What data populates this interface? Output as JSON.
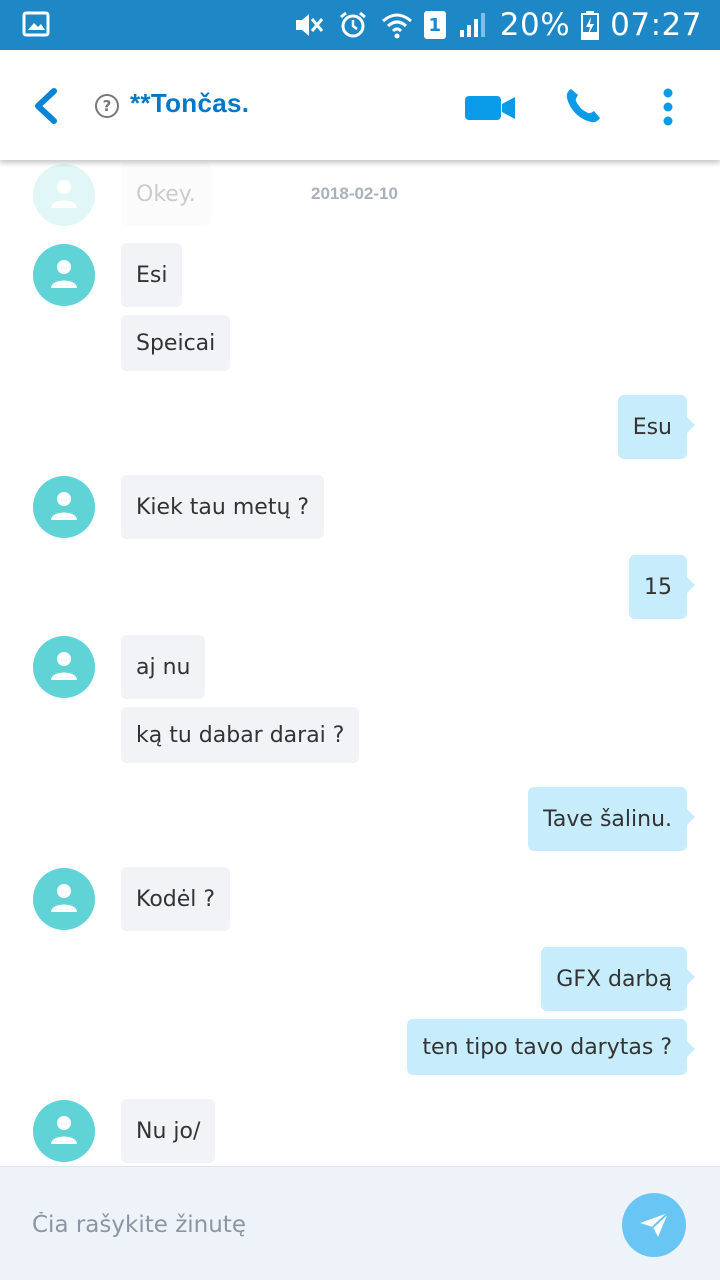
{
  "status_bar": {
    "battery": "20%",
    "time": "07:27",
    "sim_slot": "1"
  },
  "header": {
    "contact_name": "**Tončas."
  },
  "date_separator": "2018-02-10",
  "messages": [
    {
      "direction": "in",
      "text": "Okey.",
      "faded": true
    },
    {
      "direction": "in",
      "text": "Esi"
    },
    {
      "direction": "in",
      "text": "Speicai"
    },
    {
      "direction": "out",
      "text": "Esu"
    },
    {
      "direction": "in",
      "text": "Kiek tau metų ?"
    },
    {
      "direction": "out",
      "text": "15"
    },
    {
      "direction": "in",
      "text": "aj nu"
    },
    {
      "direction": "in",
      "text": "ką tu dabar darai ?"
    },
    {
      "direction": "out",
      "text": "Tave šalinu."
    },
    {
      "direction": "in",
      "text": "Kodėl ?"
    },
    {
      "direction": "out",
      "text": "GFX darbą"
    },
    {
      "direction": "out",
      "text": "ten tipo tavo darytas ?"
    },
    {
      "direction": "in",
      "text": "Nu jo/"
    }
  ],
  "composer": {
    "placeholder": "Čia rašykite žinutę"
  },
  "colors": {
    "status_bar": "#1e88c7",
    "accent": "#0078c8",
    "avatar": "#5fd3d6",
    "incoming_bubble": "#f1f3f6",
    "outgoing_bubble": "#c7ecfc",
    "send_button": "#69c6f4"
  },
  "icons": {
    "status_left": "gallery-icon",
    "status_right": [
      "mute-icon",
      "alarm-icon",
      "wifi-icon",
      "sim-icon",
      "signal-icon",
      "battery-charging-icon"
    ],
    "header": [
      "back-icon",
      "help-icon",
      "video-call-icon",
      "voice-call-icon",
      "more-options-icon"
    ],
    "composer": [
      "send-icon"
    ]
  }
}
